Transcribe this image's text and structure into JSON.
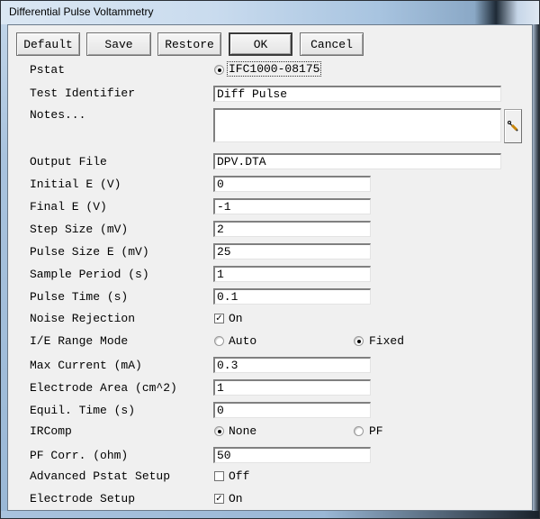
{
  "window": {
    "title": "Differential Pulse Voltammetry"
  },
  "toolbar": {
    "default_label": "Default",
    "save_label": "Save",
    "restore_label": "Restore",
    "ok_label": "OK",
    "cancel_label": "Cancel"
  },
  "form": {
    "pstat": {
      "label": "Pstat",
      "option": "IFC1000-08175",
      "selected": true
    },
    "test_identifier": {
      "label": "Test Identifier",
      "value": "Diff Pulse"
    },
    "notes": {
      "label": "Notes...",
      "value": "",
      "button_icon": "edit-notes-icon"
    },
    "output_file": {
      "label": "Output File",
      "value": "DPV.DTA"
    },
    "initial_e": {
      "label": "Initial E (V)",
      "value": "0"
    },
    "final_e": {
      "label": "Final E (V)",
      "value": "-1"
    },
    "step_size": {
      "label": "Step Size (mV)",
      "value": "2"
    },
    "pulse_size": {
      "label": "Pulse Size E (mV)",
      "value": "25"
    },
    "sample_period": {
      "label": "Sample Period (s)",
      "value": "1"
    },
    "pulse_time": {
      "label": "Pulse Time (s)",
      "value": "0.1"
    },
    "noise_rejection": {
      "label": "Noise Rejection",
      "option": "On",
      "checked": true
    },
    "ie_range_mode": {
      "label": "I/E Range Mode",
      "options": [
        "Auto",
        "Fixed"
      ],
      "selected": "Fixed"
    },
    "max_current": {
      "label": "Max Current (mA)",
      "value": "0.3"
    },
    "electrode_area": {
      "label": "Electrode Area (cm^2)",
      "value": "1"
    },
    "equil_time": {
      "label": "Equil. Time (s)",
      "value": "0"
    },
    "ircomp": {
      "label": "IRComp",
      "options": [
        "None",
        "PF"
      ],
      "selected": "None"
    },
    "pf_corr": {
      "label": "PF Corr. (ohm)",
      "value": "50"
    },
    "advanced_pstat": {
      "label": "Advanced Pstat Setup",
      "option": "Off",
      "checked": false
    },
    "electrode_setup": {
      "label": "Electrode Setup",
      "option": "On",
      "checked": true
    }
  }
}
